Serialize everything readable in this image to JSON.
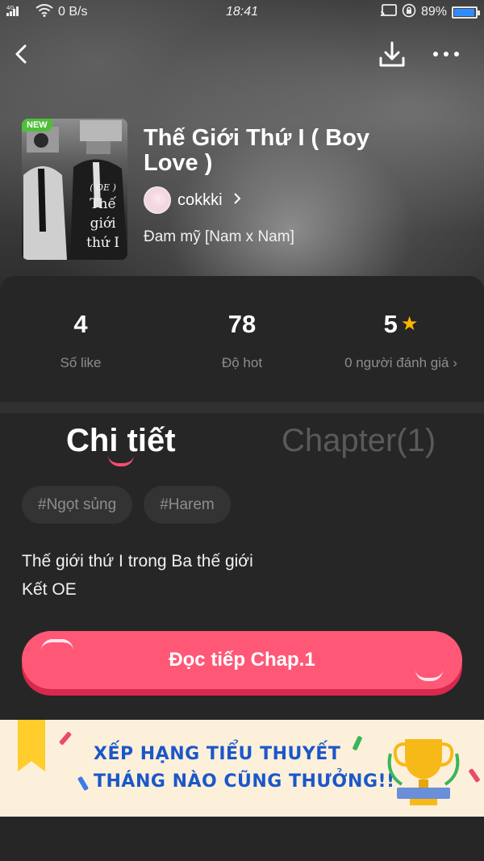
{
  "status_bar": {
    "network": "4G",
    "speed": "0 B/s",
    "time": "18:41",
    "battery": "89%",
    "battery_level": 0.89
  },
  "book": {
    "badge": "NEW",
    "cover_text_1": "( OE )",
    "cover_text_2": "Thế",
    "cover_text_3": "giới",
    "cover_text_4": "thứ I",
    "title": "Thế Giới Thứ I ( Boy Love )",
    "author": "cokkki",
    "genre": "Đam mỹ [Nam x Nam]"
  },
  "stats": {
    "likes_value": "4",
    "likes_label": "Số like",
    "hot_value": "78",
    "hot_label": "Độ hot",
    "rating_value": "5",
    "rating_label": "0 người đánh giá"
  },
  "tabs": {
    "detail": "Chi tiết",
    "chapter": "Chapter(1)"
  },
  "tags": [
    "#Ngọt sủng",
    "#Harem"
  ],
  "description": {
    "line1": "Thế giới thứ I trong Ba thế giới",
    "line2": "Kết OE"
  },
  "read_button": "Đọc tiếp Chap.1",
  "banner": {
    "line1": "XẾP HẠNG TIỂU THUYẾT",
    "line2": "THÁNG NÀO CŨNG THƯỞNG!!"
  },
  "colors": {
    "accent": "#ff5877",
    "accent_shadow": "#d8284d",
    "star": "#ffb400",
    "banner_text": "#1b57c9"
  }
}
